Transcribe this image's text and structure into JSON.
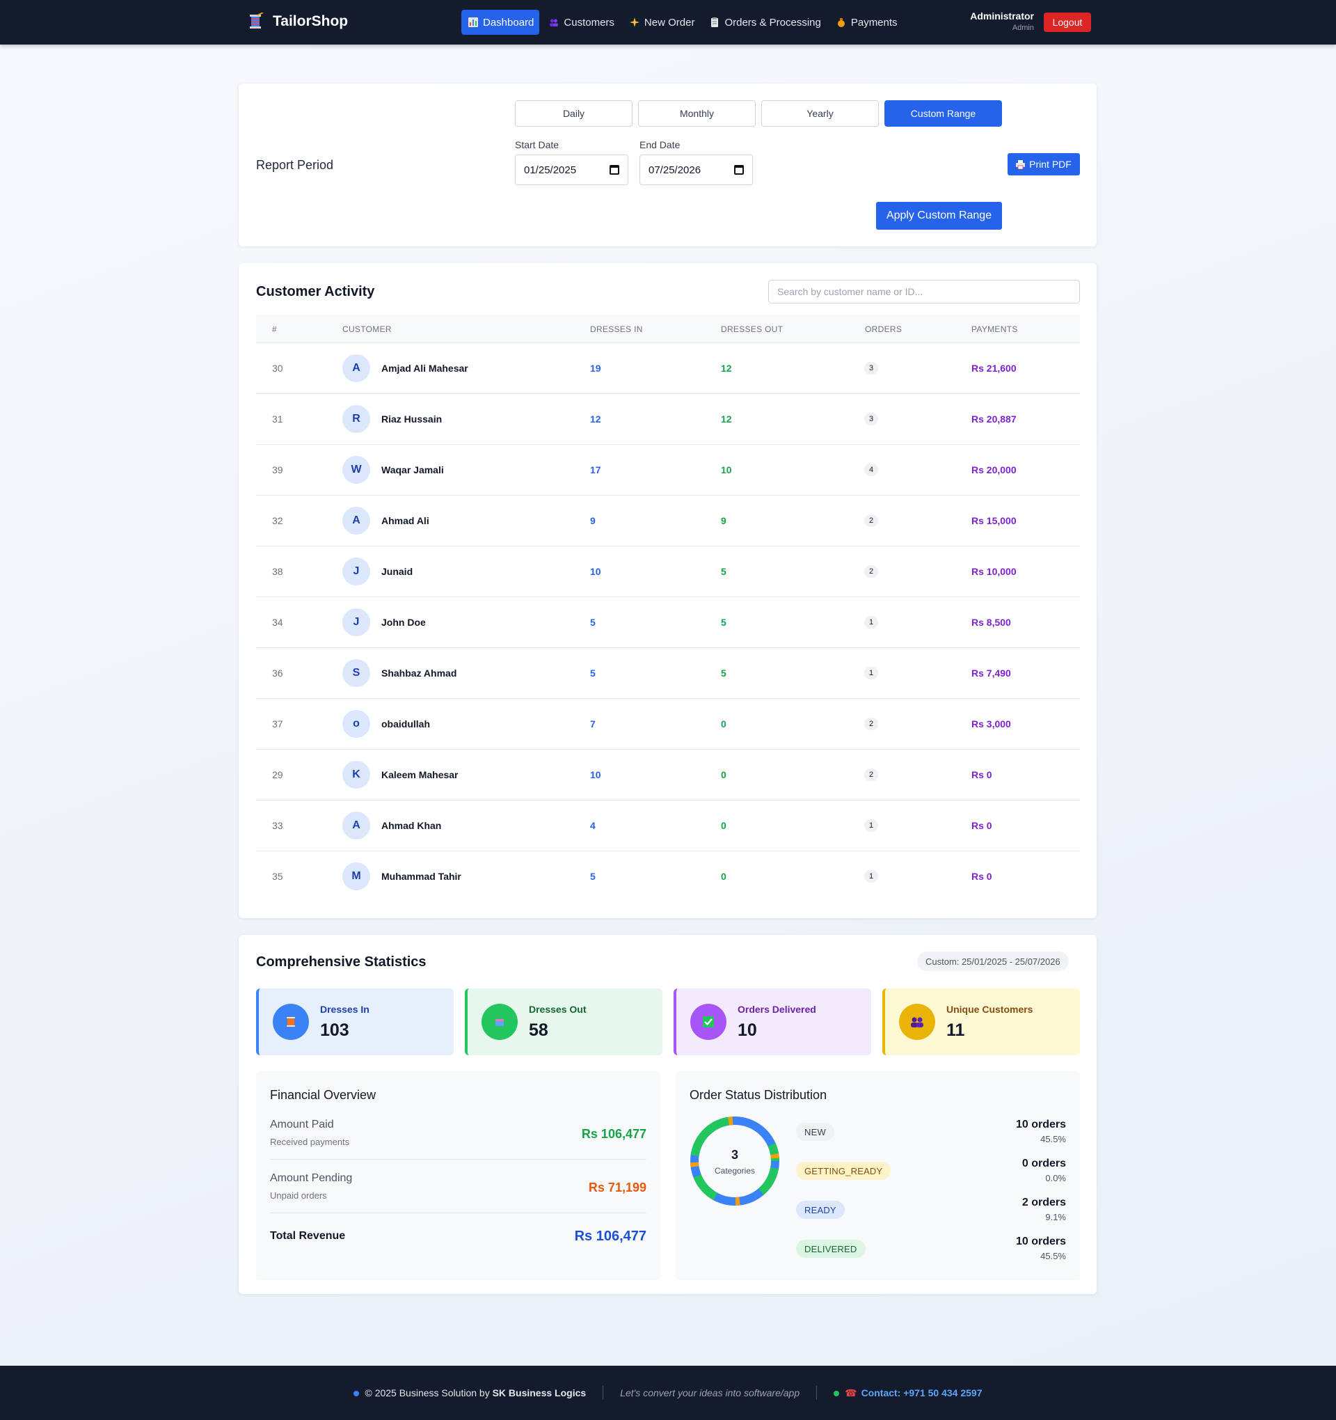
{
  "navbar": {
    "brand": "TailorShop",
    "items": [
      {
        "label": "Dashboard",
        "icon": "bar-chart-icon",
        "active": true
      },
      {
        "label": "Customers",
        "icon": "users-icon"
      },
      {
        "label": "New Order",
        "icon": "sparkles-icon"
      },
      {
        "label": "Orders & Processing",
        "icon": "clipboard-icon"
      },
      {
        "label": "Payments",
        "icon": "money-bag-icon"
      }
    ],
    "user_name": "Administrator",
    "user_role": "Admin",
    "logout_label": "Logout"
  },
  "report_period": {
    "title": "Report Period",
    "periods": [
      "Daily",
      "Monthly",
      "Yearly",
      "Custom Range"
    ],
    "active_period": "Custom Range",
    "start_label": "Start Date",
    "start_value": "01/25/2025",
    "end_label": "End Date",
    "end_value": "07/25/2026",
    "print_label": "Print PDF",
    "apply_label": "Apply Custom Range"
  },
  "customer_activity": {
    "title": "Customer Activity",
    "search_placeholder": "Search by customer name or ID...",
    "columns": [
      "#",
      "CUSTOMER",
      "DRESSES IN",
      "DRESSES OUT",
      "ORDERS",
      "PAYMENTS"
    ],
    "rows": [
      {
        "id": "30",
        "initial": "A",
        "name": "Amjad Ali Mahesar",
        "in": "19",
        "out": "12",
        "orders": "3",
        "payments": "Rs 21,600"
      },
      {
        "id": "31",
        "initial": "R",
        "name": "Riaz Hussain",
        "in": "12",
        "out": "12",
        "orders": "3",
        "payments": "Rs 20,887"
      },
      {
        "id": "39",
        "initial": "W",
        "name": "Waqar Jamali",
        "in": "17",
        "out": "10",
        "orders": "4",
        "payments": "Rs 20,000"
      },
      {
        "id": "32",
        "initial": "A",
        "name": "Ahmad Ali",
        "in": "9",
        "out": "9",
        "orders": "2",
        "payments": "Rs 15,000"
      },
      {
        "id": "38",
        "initial": "J",
        "name": "Junaid",
        "in": "10",
        "out": "5",
        "orders": "2",
        "payments": "Rs 10,000"
      },
      {
        "id": "34",
        "initial": "J",
        "name": "John Doe",
        "in": "5",
        "out": "5",
        "orders": "1",
        "payments": "Rs 8,500"
      },
      {
        "id": "36",
        "initial": "S",
        "name": "Shahbaz Ahmad",
        "in": "5",
        "out": "5",
        "orders": "1",
        "payments": "Rs 7,490"
      },
      {
        "id": "37",
        "initial": "o",
        "name": "obaidullah",
        "in": "7",
        "out": "0",
        "orders": "2",
        "payments": "Rs 3,000"
      },
      {
        "id": "29",
        "initial": "K",
        "name": "Kaleem Mahesar",
        "in": "10",
        "out": "0",
        "orders": "2",
        "payments": "Rs 0"
      },
      {
        "id": "33",
        "initial": "A",
        "name": "Ahmad Khan",
        "in": "4",
        "out": "0",
        "orders": "1",
        "payments": "Rs 0"
      },
      {
        "id": "35",
        "initial": "M",
        "name": "Muhammad Tahir",
        "in": "5",
        "out": "0",
        "orders": "1",
        "payments": "Rs 0"
      }
    ]
  },
  "statistics": {
    "title": "Comprehensive Statistics",
    "range_badge": "Custom: 25/01/2025 - 25/07/2026",
    "cards": [
      {
        "label": "Dresses In",
        "value": "103",
        "icon": "thread-spool-icon",
        "color": "#3b82f6",
        "bg": "#e6effc",
        "label_color": "#1e40af"
      },
      {
        "label": "Dresses Out",
        "value": "58",
        "icon": "package-icon",
        "color": "#22c55e",
        "bg": "#e6f8ed",
        "label_color": "#166534"
      },
      {
        "label": "Orders Delivered",
        "value": "10",
        "icon": "check-icon",
        "color": "#a855f7",
        "bg": "#f3ebfc",
        "label_color": "#6b21a8"
      },
      {
        "label": "Unique Customers",
        "value": "11",
        "icon": "users-icon",
        "color": "#eab308",
        "bg": "#fdf8d4",
        "label_color": "#854d0e"
      }
    ],
    "financial": {
      "title": "Financial Overview",
      "paid_label": "Amount Paid",
      "paid_sub": "Received payments",
      "paid_value": "Rs 106,477",
      "pending_label": "Amount Pending",
      "pending_sub": "Unpaid orders",
      "pending_value": "Rs 71,199",
      "total_label": "Total Revenue",
      "total_value": "Rs 106,477"
    },
    "order_status": {
      "title": "Order Status Distribution",
      "center_value": "3",
      "center_label": "Categories",
      "statuses": [
        {
          "label": "NEW",
          "orders": "10 orders",
          "pct": "45.5%",
          "bg": "#f0f1f3",
          "fg": "#374151"
        },
        {
          "label": "GETTING_READY",
          "orders": "0 orders",
          "pct": "0.0%",
          "bg": "#fdf3c8",
          "fg": "#854d0e"
        },
        {
          "label": "READY",
          "orders": "2 orders",
          "pct": "9.1%",
          "bg": "#dbe7fb",
          "fg": "#1e40af"
        },
        {
          "label": "DELIVERED",
          "orders": "10 orders",
          "pct": "45.5%",
          "bg": "#dcf5e3",
          "fg": "#166534"
        }
      ]
    }
  },
  "footer": {
    "copyright": "© 2025 Business Solution by ",
    "company": "SK Business Logics",
    "tagline": "Let's convert your ideas into software/app",
    "contact": "Contact: +971 50 434 2597"
  }
}
